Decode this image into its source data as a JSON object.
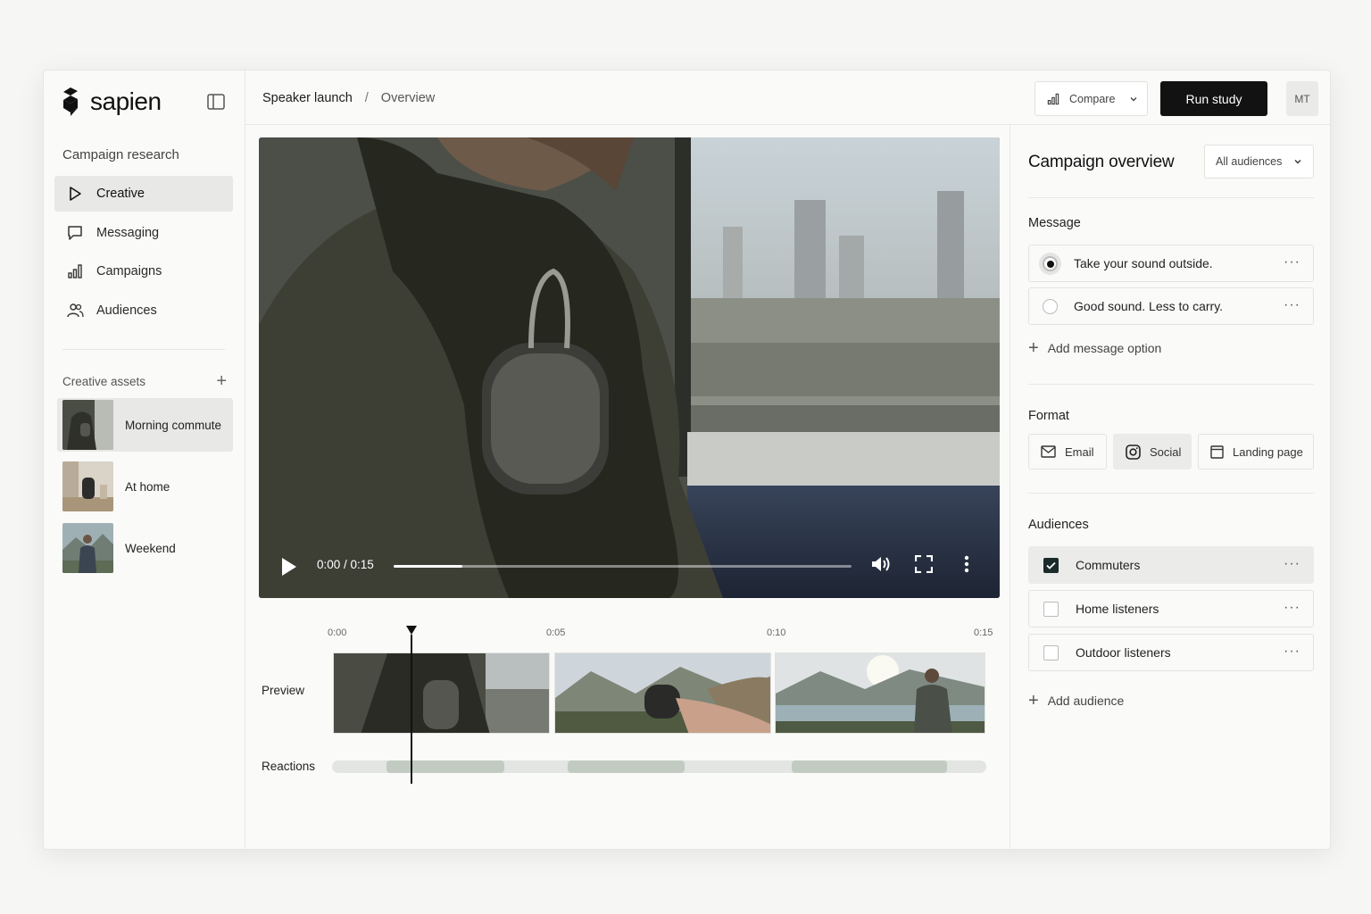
{
  "app": {
    "name": "sapien"
  },
  "sidebar": {
    "section_title": "Campaign research",
    "items": [
      {
        "label": "Creative",
        "icon": "play-outline-icon",
        "active": true
      },
      {
        "label": "Messaging",
        "icon": "chat-bubble-icon",
        "active": false
      },
      {
        "label": "Campaigns",
        "icon": "bar-chart-icon",
        "active": false
      },
      {
        "label": "Audiences",
        "icon": "users-icon",
        "active": false
      }
    ],
    "assets_title": "Creative assets",
    "assets": [
      {
        "label": "Morning commute",
        "active": true
      },
      {
        "label": "At home",
        "active": false
      },
      {
        "label": "Weekend",
        "active": false
      }
    ]
  },
  "header": {
    "breadcrumb": [
      "Speaker launch",
      "Overview"
    ],
    "separator": "/",
    "compare_label": "Compare",
    "run_label": "Run study",
    "avatar_initials": "MT"
  },
  "video": {
    "time": "0:00 / 0:15",
    "progress": 0.15
  },
  "timeline": {
    "ticks": [
      "0:00",
      "0:05",
      "0:10",
      "0:15"
    ],
    "preview_label": "Preview",
    "reactions_label": "Reactions"
  },
  "panel": {
    "title": "Campaign overview",
    "audience_select": "All audiences",
    "message_label": "Message",
    "messages": [
      {
        "text": "Take your sound outside.",
        "selected": true
      },
      {
        "text": "Good sound. Less to carry.",
        "selected": false
      }
    ],
    "add_message": "Add message option",
    "format_label": "Format",
    "formats": [
      {
        "label": "Email",
        "icon": "mail-icon",
        "active": false
      },
      {
        "label": "Social",
        "icon": "instagram-icon",
        "active": true
      },
      {
        "label": "Landing page",
        "icon": "browser-window-icon",
        "active": false
      }
    ],
    "audiences_label": "Audiences",
    "audiences": [
      {
        "label": "Commuters",
        "checked": true
      },
      {
        "label": "Home listeners",
        "checked": false
      },
      {
        "label": "Outdoor listeners",
        "checked": false
      }
    ],
    "add_audience": "Add audience"
  },
  "colors": {
    "accent_dark": "#121212",
    "active_bg": "#e8e9e6",
    "reaction_fill": "#c1cbc2"
  }
}
